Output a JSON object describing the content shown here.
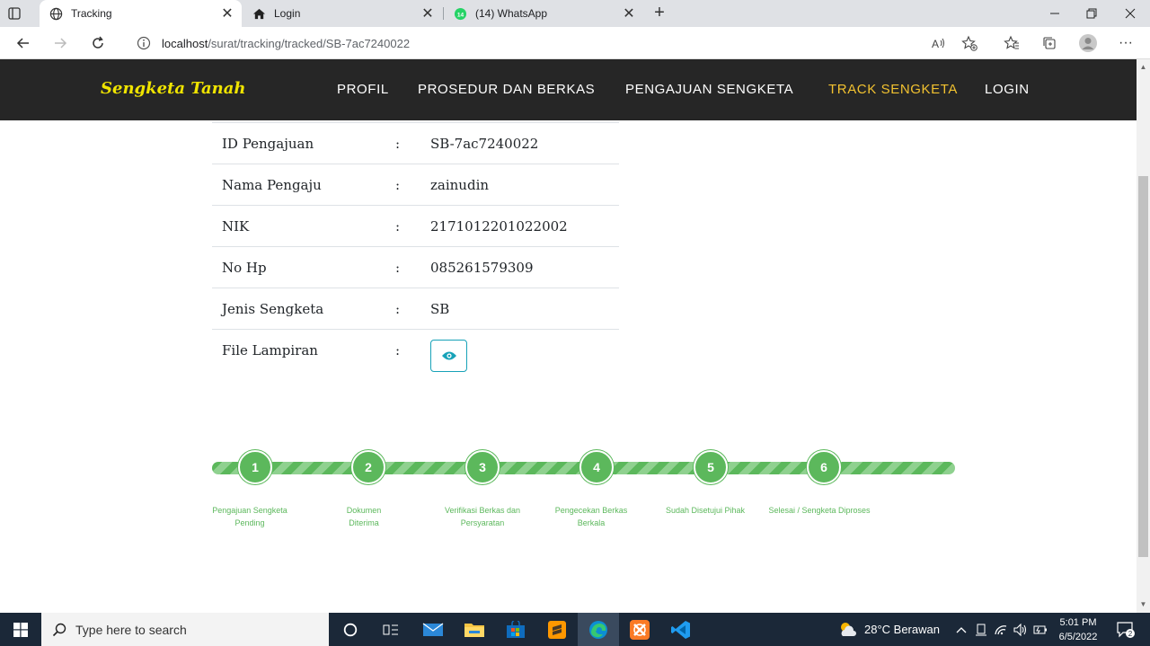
{
  "browser": {
    "tabs": [
      {
        "title": "Tracking",
        "icon": "globe-icon",
        "active": true
      },
      {
        "title": "Login",
        "icon": "home-icon",
        "active": false
      },
      {
        "title": "(14) WhatsApp",
        "icon": "whatsapp-icon",
        "active": false,
        "badge": "14"
      }
    ],
    "new_tab": "+",
    "url_host": "localhost",
    "url_path": "/surat/tracking/tracked/SB-7ac7240022"
  },
  "site": {
    "brand": "Sengketa Tanah",
    "nav": [
      "PROFIL",
      "PROSEDUR DAN BERKAS",
      "PENGAJUAN SENGKETA",
      "TRACK SENGKETA",
      "LOGIN"
    ],
    "active_nav": "TRACK SENGKETA",
    "colors": {
      "navbar": "#262626",
      "brand": "#f0e400",
      "active": "#f2c230",
      "progress": "#5cb85c",
      "view_button": "#17a2b8"
    }
  },
  "details": [
    {
      "label": "ID Pengajuan",
      "sep": ":",
      "value": "SB-7ac7240022"
    },
    {
      "label": "Nama Pengaju",
      "sep": ":",
      "value": "zainudin"
    },
    {
      "label": "NIK",
      "sep": ":",
      "value": "2171012201022002"
    },
    {
      "label": "No Hp",
      "sep": ":",
      "value": "085261579309"
    },
    {
      "label": "Jenis Sengketa",
      "sep": ":",
      "value": "SB"
    },
    {
      "label": "File Lampiran",
      "sep": ":",
      "value": ""
    }
  ],
  "steps": [
    {
      "number": "1",
      "label": "Pengajuan Sengketa Pending"
    },
    {
      "number": "2",
      "label": "Dokumen Diterima"
    },
    {
      "number": "3",
      "label": "Verifikasi Berkas dan Persyaratan"
    },
    {
      "number": "4",
      "label": "Pengecekan Berkas Berkala"
    },
    {
      "number": "5",
      "label": "Sudah Disetujui Pihak"
    },
    {
      "number": "6",
      "label": "Selesai / Sengketa Diproses"
    }
  ],
  "taskbar": {
    "search_placeholder": "Type here to search",
    "weather": "28°C  Berawan",
    "time": "5:01 PM",
    "date": "6/5/2022",
    "notifications": "2"
  }
}
